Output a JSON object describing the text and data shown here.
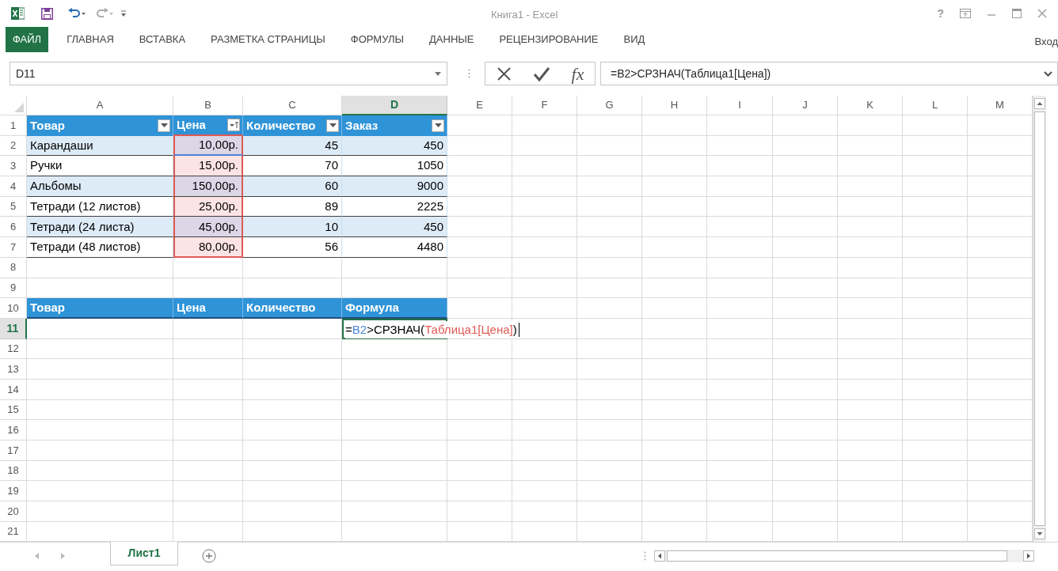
{
  "window": {
    "title": "Книга1 - Excel"
  },
  "ribbon_tabs": [
    {
      "label": "ФАЙЛ",
      "selected": true
    },
    {
      "label": "ГЛАВНАЯ",
      "selected": false
    },
    {
      "label": "ВСТАВКА",
      "selected": false
    },
    {
      "label": "РАЗМЕТКА СТРАНИЦЫ",
      "selected": false
    },
    {
      "label": "ФОРМУЛЫ",
      "selected": false
    },
    {
      "label": "ДАННЫЕ",
      "selected": false
    },
    {
      "label": "РЕЦЕНЗИРОВАНИЕ",
      "selected": false
    },
    {
      "label": "ВИД",
      "selected": false
    }
  ],
  "help": "?",
  "sign_in": "Вход",
  "function_button": "fx",
  "name_box": "D11",
  "formula": "=B2>СРЗНАЧ(Таблица1[Цена])",
  "columns": [
    {
      "label": "A",
      "selected": false
    },
    {
      "label": "B",
      "selected": false
    },
    {
      "label": "C",
      "selected": false
    },
    {
      "label": "D",
      "selected": true
    },
    {
      "label": "E",
      "selected": false
    },
    {
      "label": "F",
      "selected": false
    },
    {
      "label": "G",
      "selected": false
    },
    {
      "label": "H",
      "selected": false
    },
    {
      "label": "I",
      "selected": false
    },
    {
      "label": "J",
      "selected": false
    },
    {
      "label": "K",
      "selected": false
    },
    {
      "label": "L",
      "selected": false
    },
    {
      "label": "M",
      "selected": false
    }
  ],
  "rows": [
    {
      "label": "1",
      "selected": false
    },
    {
      "label": "2",
      "selected": false
    },
    {
      "label": "3",
      "selected": false
    },
    {
      "label": "4",
      "selected": false
    },
    {
      "label": "5",
      "selected": false
    },
    {
      "label": "6",
      "selected": false
    },
    {
      "label": "7",
      "selected": false
    },
    {
      "label": "8",
      "selected": false
    },
    {
      "label": "9",
      "selected": false
    },
    {
      "label": "10",
      "selected": false
    },
    {
      "label": "11",
      "selected": true
    },
    {
      "label": "12",
      "selected": false
    },
    {
      "label": "13",
      "selected": false
    },
    {
      "label": "14",
      "selected": false
    },
    {
      "label": "15",
      "selected": false
    },
    {
      "label": "16",
      "selected": false
    },
    {
      "label": "17",
      "selected": false
    },
    {
      "label": "18",
      "selected": false
    },
    {
      "label": "19",
      "selected": false
    },
    {
      "label": "20",
      "selected": false
    },
    {
      "label": "21",
      "selected": false
    }
  ],
  "table": {
    "header": [
      {
        "label": "Товар",
        "kind": "filter",
        "referenced": false
      },
      {
        "label": "Цена",
        "kind": "sort",
        "referenced": true
      },
      {
        "label": "Количество",
        "kind": "filter",
        "referenced": false
      },
      {
        "label": "Заказ",
        "kind": "filter",
        "referenced": false
      }
    ],
    "rows": [
      [
        "Карандаши",
        "10,00р.",
        "45",
        "450"
      ],
      [
        "Ручки",
        "15,00р.",
        "70",
        "1050"
      ],
      [
        "Альбомы",
        "150,00р.",
        "60",
        "9000"
      ],
      [
        "Тетради (12 листов)",
        "25,00р.",
        "89",
        "2225"
      ],
      [
        "Тетради (24 листа)",
        "45,00р.",
        "10",
        "450"
      ],
      [
        "Тетради (48 листов)",
        "80,00р.",
        "56",
        "4480"
      ]
    ]
  },
  "table2": {
    "header": [
      "Товар",
      "Цена",
      "Количество",
      "Формула"
    ]
  },
  "editing_cell": {
    "parts": [
      {
        "text": "="
      },
      {
        "text": "B2",
        "color": "#4a86d8"
      },
      {
        "text": ">СРЗНАЧ("
      },
      {
        "text": "Таблица1[Цена]",
        "color": "#e05a55"
      },
      {
        "text": ")"
      }
    ]
  },
  "sheet_tabs": [
    {
      "label": "Лист1",
      "selected": true
    }
  ]
}
